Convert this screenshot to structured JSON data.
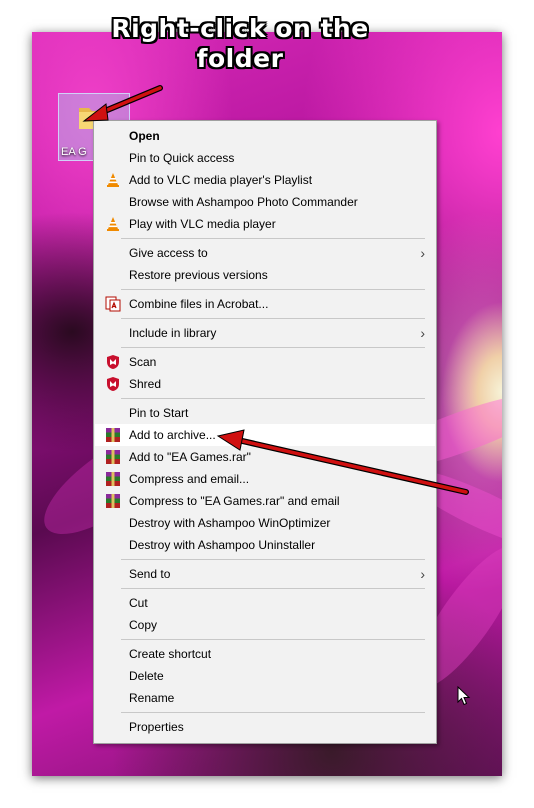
{
  "annotation": {
    "line1": "Right-click on the",
    "line2": "folder",
    "arrow_color": "#d01010"
  },
  "desktop": {
    "folder_label": "EA Games",
    "folder_label_visible": "EA G"
  },
  "menu": {
    "items": [
      {
        "label": "Open",
        "bold": true,
        "icon": "",
        "submenu": false
      },
      {
        "label": "Pin to Quick access",
        "icon": "",
        "submenu": false
      },
      {
        "label": "Add to VLC media player's Playlist",
        "icon": "vlc-cone-icon",
        "submenu": false
      },
      {
        "label": "Browse with Ashampoo Photo Commander",
        "icon": "",
        "submenu": false
      },
      {
        "label": "Play with VLC media player",
        "icon": "vlc-cone-icon",
        "submenu": false
      },
      {
        "label": "Give access to",
        "icon": "",
        "submenu": true
      },
      {
        "label": "Restore previous versions",
        "icon": "",
        "submenu": false
      },
      {
        "label": "Combine files in Acrobat...",
        "icon": "acrobat-combine-icon",
        "submenu": false
      },
      {
        "label": "Include in library",
        "icon": "",
        "submenu": true
      },
      {
        "label": "Scan",
        "icon": "mcafee-shield-icon",
        "submenu": false
      },
      {
        "label": "Shred",
        "icon": "mcafee-shield-icon",
        "submenu": false
      },
      {
        "label": "Pin to Start",
        "icon": "",
        "submenu": false
      },
      {
        "label": "Add to archive...",
        "icon": "winrar-icon",
        "submenu": false,
        "highlighted": true
      },
      {
        "label": "Add to \"EA Games.rar\"",
        "icon": "winrar-icon",
        "submenu": false
      },
      {
        "label": "Compress and email...",
        "icon": "winrar-icon",
        "submenu": false
      },
      {
        "label": "Compress to \"EA Games.rar\" and email",
        "icon": "winrar-icon",
        "submenu": false
      },
      {
        "label": "Destroy with Ashampoo WinOptimizer",
        "icon": "",
        "submenu": false
      },
      {
        "label": "Destroy with Ashampoo Uninstaller",
        "icon": "",
        "submenu": false
      },
      {
        "label": "Send to",
        "icon": "",
        "submenu": true
      },
      {
        "label": "Cut",
        "icon": "",
        "submenu": false
      },
      {
        "label": "Copy",
        "icon": "",
        "submenu": false
      },
      {
        "label": "Create shortcut",
        "icon": "",
        "submenu": false
      },
      {
        "label": "Delete",
        "icon": "",
        "submenu": false
      },
      {
        "label": "Rename",
        "icon": "",
        "submenu": false
      },
      {
        "label": "Properties",
        "icon": "",
        "submenu": false
      }
    ],
    "submenu_glyph": "›"
  },
  "colors": {
    "menu_bg": "#f2f2f2",
    "highlight_bg": "#ffffff",
    "vlc_orange": "#f08a00",
    "mcafee_red": "#c8102e",
    "winrar_purple": "#6a2a8a"
  }
}
